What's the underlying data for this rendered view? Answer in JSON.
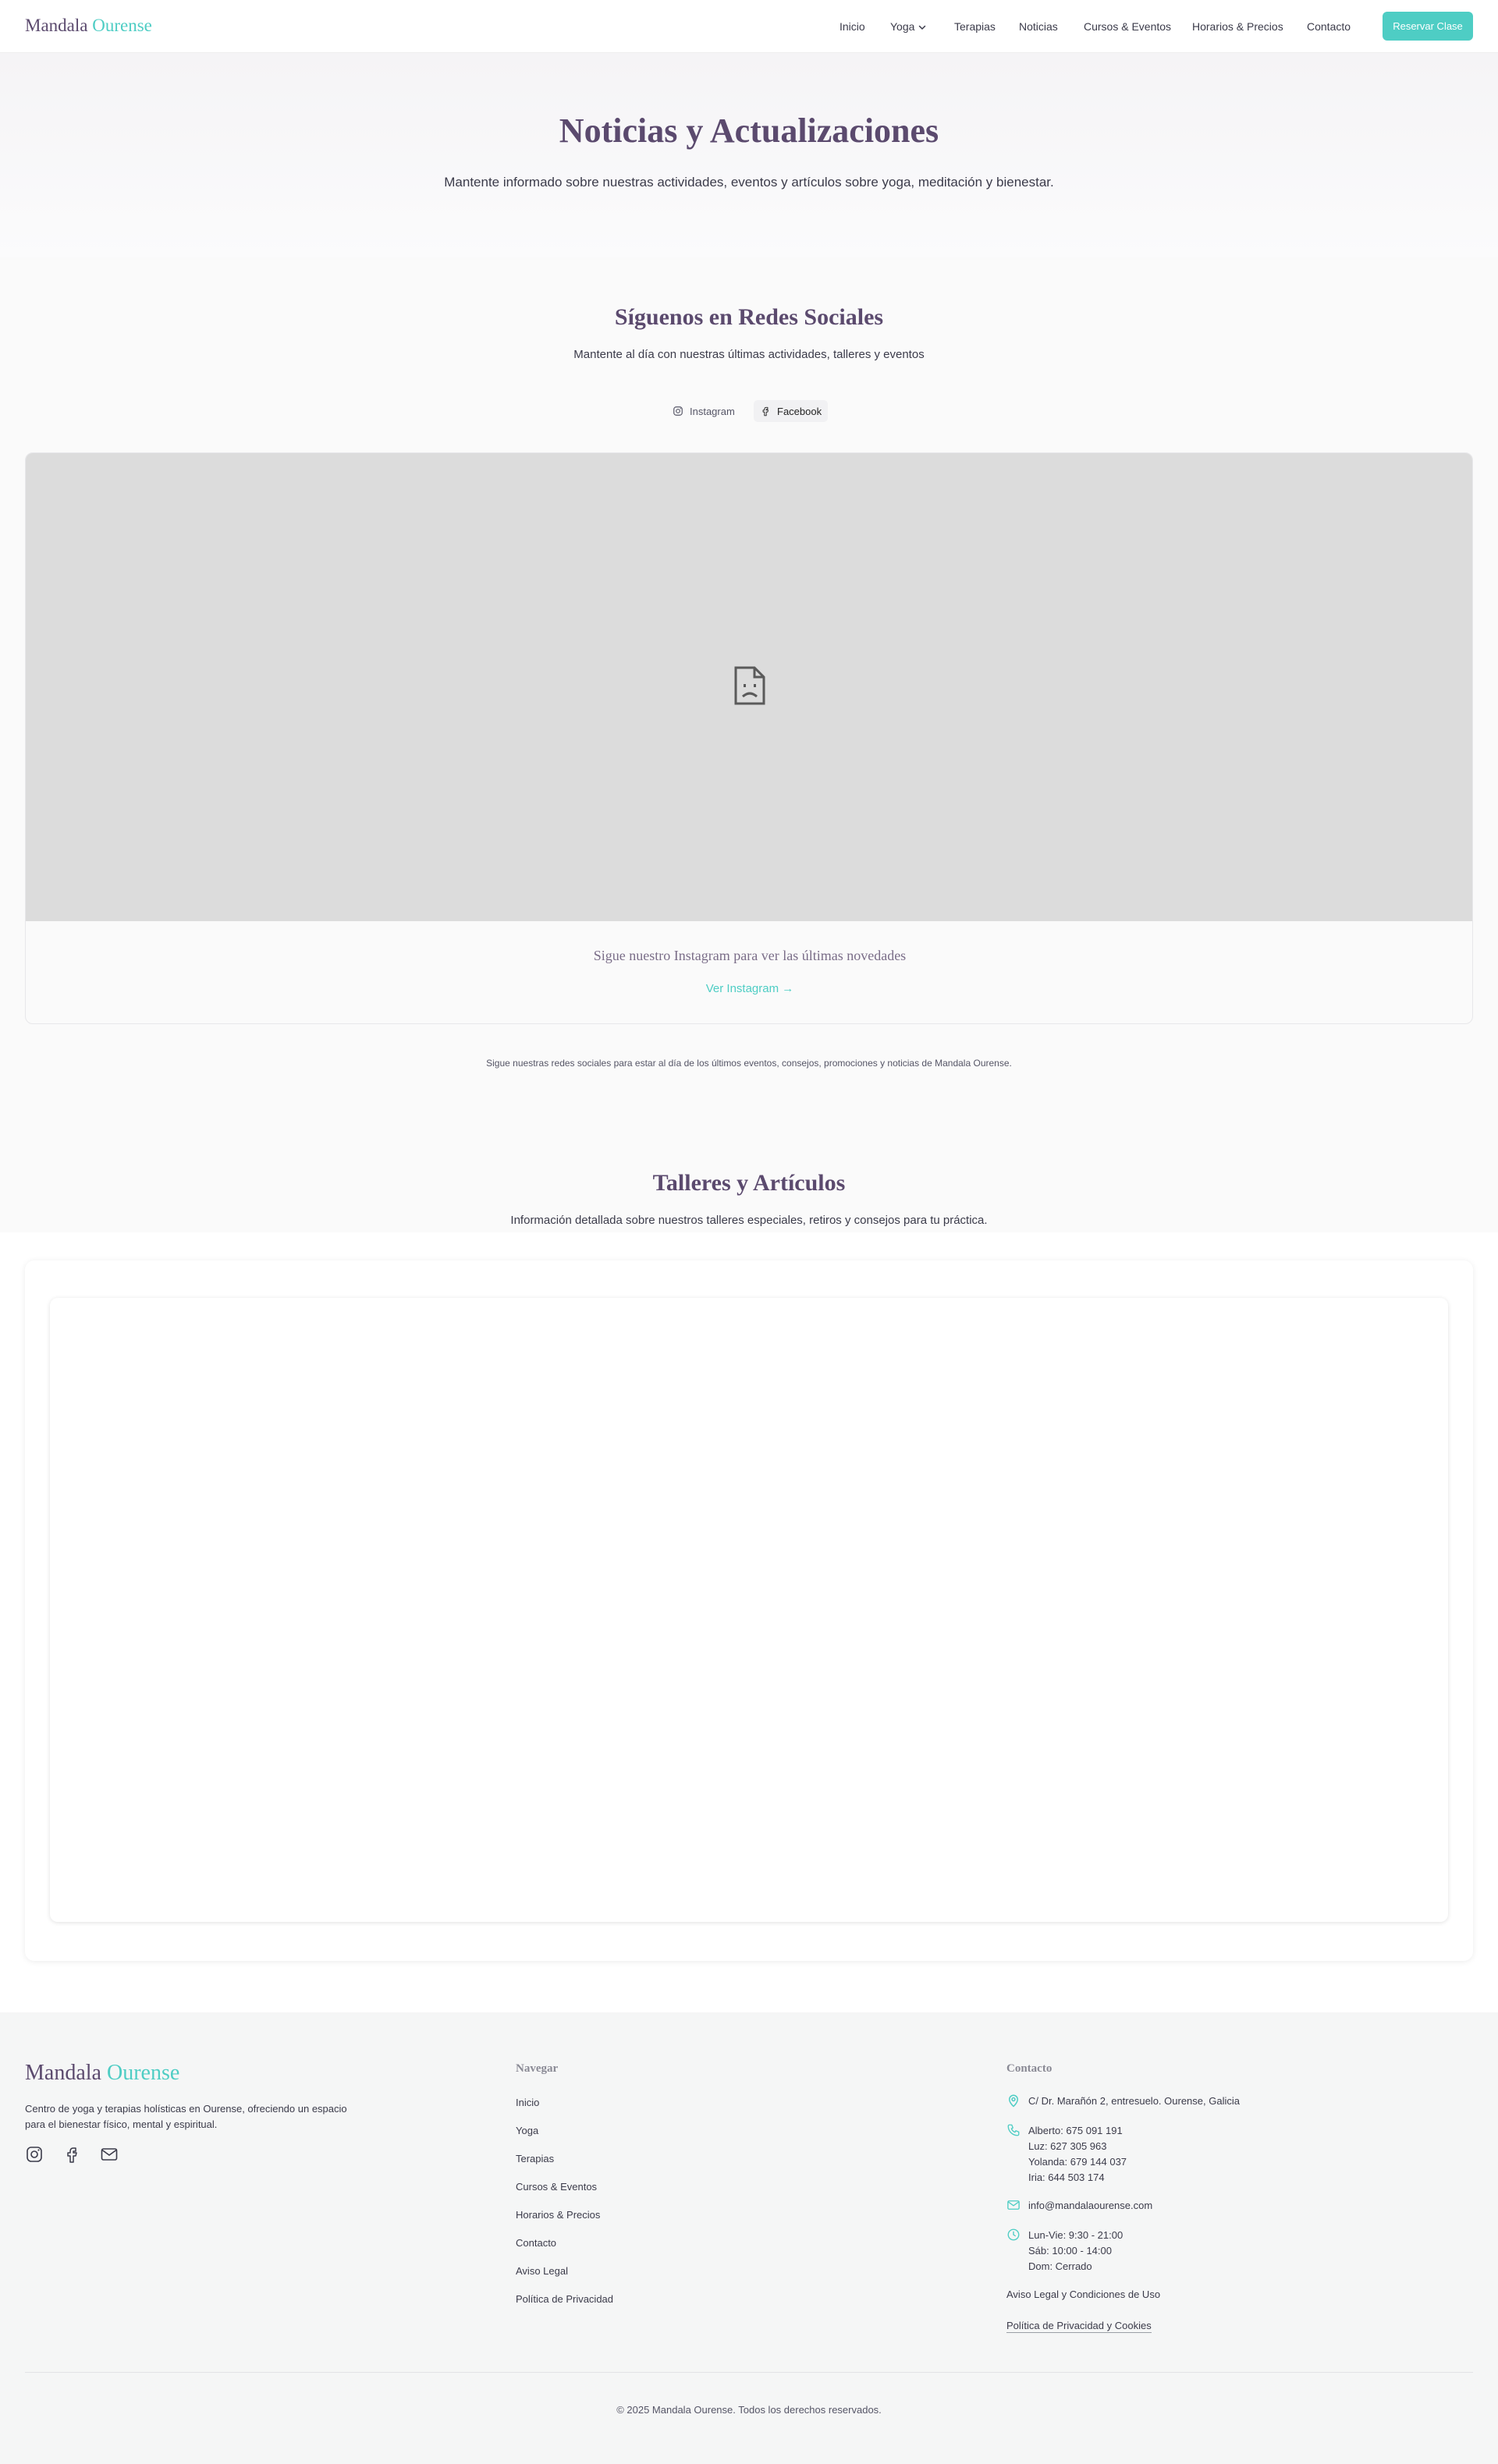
{
  "header": {
    "logo": {
      "part1": "Mandala",
      "part2": "Ourense"
    },
    "nav": [
      {
        "label": "Inicio"
      },
      {
        "label": "Yoga"
      },
      {
        "label": "Terapias"
      },
      {
        "label": "Noticias"
      },
      {
        "label": "Cursos & Eventos"
      },
      {
        "label": "Horarios & Precios"
      },
      {
        "label": "Contacto"
      }
    ],
    "cta": "Reservar Clase"
  },
  "hero": {
    "title": "Noticias y Actualizaciones",
    "subtitle": "Mantente informado sobre nuestras actividades, eventos y artículos sobre yoga, meditación y bienestar."
  },
  "social": {
    "title": "Síguenos en Redes Sociales",
    "subtitle": "Mantente al día con nuestras últimas actividades, talleres y eventos",
    "tabs": [
      {
        "label": "Instagram"
      },
      {
        "label": "Facebook"
      }
    ],
    "embed_caption": "Sigue nuestro Instagram para ver las últimas novedades",
    "embed_link": "Ver Instagram →",
    "footnote": "Sigue nuestras redes sociales para estar al día de los últimos eventos, consejos, promociones y noticias de Mandala Ourense."
  },
  "articles": {
    "title": "Talleres y Artículos",
    "subtitle": "Información detallada sobre nuestros talleres especiales, retiros y consejos para tu práctica."
  },
  "footer": {
    "logo": {
      "part1": "Mandala",
      "part2": "Ourense"
    },
    "description": "Centro de yoga y terapias holísticas en Ourense, ofreciendo un espacio para el bienestar físico, mental y espiritual.",
    "nav_heading": "Navegar",
    "nav_links": [
      {
        "label": "Inicio"
      },
      {
        "label": "Yoga"
      },
      {
        "label": "Terapias"
      },
      {
        "label": "Cursos & Eventos"
      },
      {
        "label": "Horarios & Precios"
      },
      {
        "label": "Contacto"
      },
      {
        "label": "Aviso Legal"
      },
      {
        "label": "Política de Privacidad"
      }
    ],
    "contact_heading": "Contacto",
    "address": "C/ Dr. Marañón 2, entresuelo. Ourense, Galicia",
    "phones": [
      "Alberto: 675 091 191",
      "Luz: 627 305 963",
      "Yolanda: 679 144 037",
      "Iria: 644 503 174"
    ],
    "email": "info@mandalaourense.com",
    "hours": [
      "Lun-Vie: 9:30 - 21:00",
      "Sáb: 10:00 - 14:00",
      "Dom: Cerrado"
    ],
    "legal_links": [
      {
        "label": "Aviso Legal y Condiciones de Uso"
      },
      {
        "label": "Política de Privacidad y Cookies"
      }
    ],
    "copyright": "© 2025 Mandala Ourense. Todos los derechos reservados."
  },
  "colors": {
    "brand": "#5b4a6e",
    "accent": "#4ecdc4",
    "footer_bg": "#f5f6f6"
  },
  "icons": [
    "chevron-down-icon",
    "instagram-icon",
    "facebook-icon",
    "broken-document-icon",
    "arrow-right-icon",
    "mail-icon",
    "map-pin-icon",
    "phone-icon",
    "clock-icon"
  ]
}
